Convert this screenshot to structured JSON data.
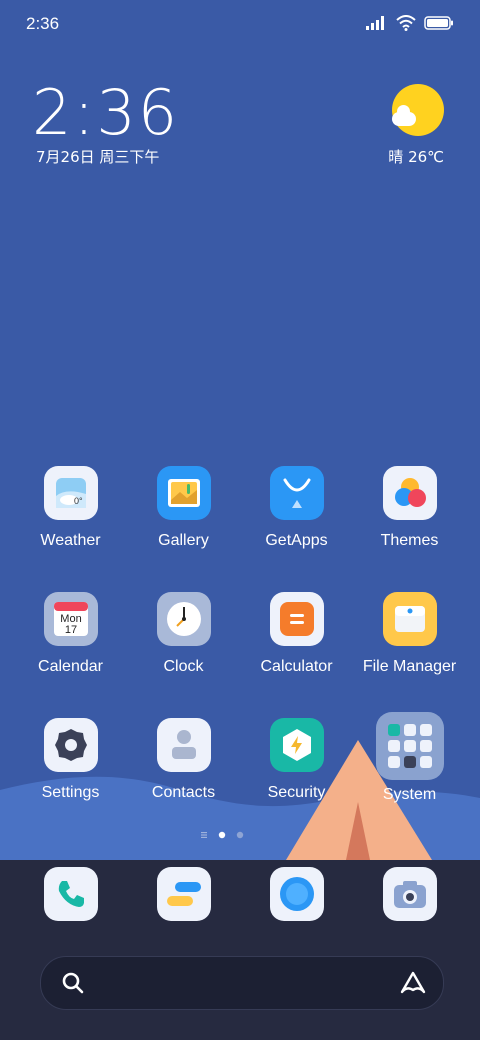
{
  "status_bar": {
    "time": "2:36",
    "icons": [
      "signal-icon",
      "wifi-icon",
      "battery-icon"
    ]
  },
  "clock_widget": {
    "time": "2:36",
    "date": "7月26日 周三下午"
  },
  "weather_widget": {
    "icon": "sun-cloud-icon",
    "text": "晴 26℃"
  },
  "apps": [
    {
      "label": "Weather",
      "icon": "weather-icon",
      "badge": "0°"
    },
    {
      "label": "Gallery",
      "icon": "gallery-icon"
    },
    {
      "label": "GetApps",
      "icon": "getapps-icon"
    },
    {
      "label": "Themes",
      "icon": "themes-icon"
    },
    {
      "label": "Calendar",
      "icon": "calendar-icon",
      "day": "Mon",
      "date": "17"
    },
    {
      "label": "Clock",
      "icon": "clock-icon"
    },
    {
      "label": "Calculator",
      "icon": "calculator-icon"
    },
    {
      "label": "File Manager",
      "icon": "file-manager-icon"
    },
    {
      "label": "Settings",
      "icon": "settings-icon"
    },
    {
      "label": "Contacts",
      "icon": "contacts-icon"
    },
    {
      "label": "Security",
      "icon": "security-icon"
    },
    {
      "label": "System",
      "icon": "system-folder-icon"
    }
  ],
  "page_indicator": {
    "pages": 2,
    "current": 1
  },
  "dock": [
    {
      "name": "phone",
      "icon": "phone-icon"
    },
    {
      "name": "messages",
      "icon": "messages-icon"
    },
    {
      "name": "browser",
      "icon": "browser-icon"
    },
    {
      "name": "camera",
      "icon": "camera-icon"
    }
  ],
  "search": {
    "icon": "search-icon",
    "assistant_icon": "assistant-icon"
  },
  "colors": {
    "wallpaper": "#3a5aa6",
    "wave": "#4a72c4",
    "dock": "#262a40",
    "sun": "#ffd21f",
    "tent": "#f4b08a"
  }
}
